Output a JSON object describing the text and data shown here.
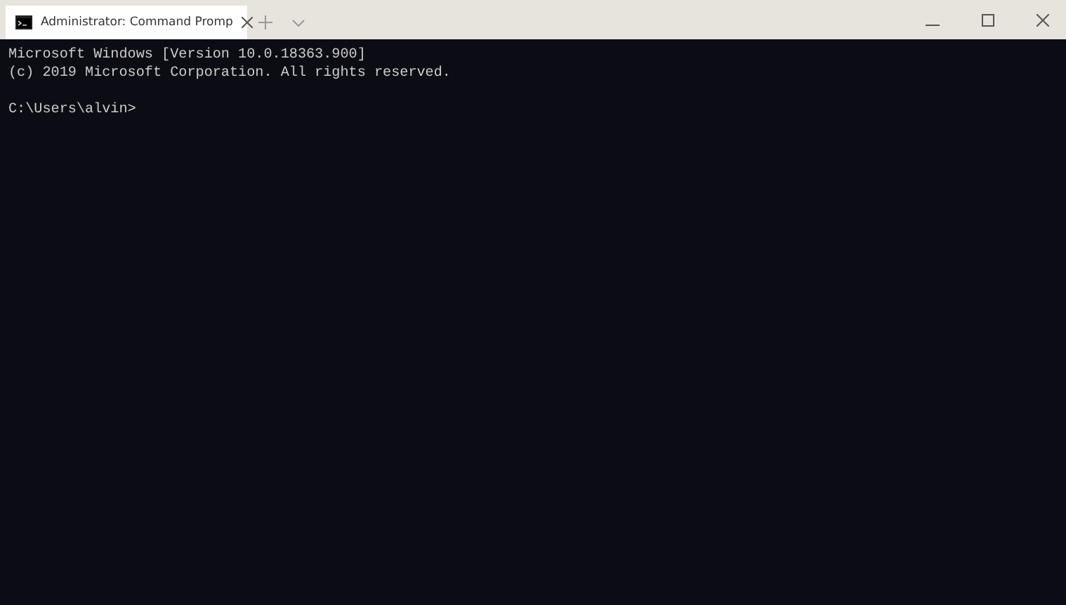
{
  "window": {
    "tab": {
      "title": "Administrator: Command Promp",
      "selected": true
    }
  },
  "terminal": {
    "lines": [
      "Microsoft Windows [Version 10.0.18363.900]",
      "(c) 2019 Microsoft Corporation. All rights reserved."
    ],
    "prompt": "C:\\Users\\alvin>"
  }
}
